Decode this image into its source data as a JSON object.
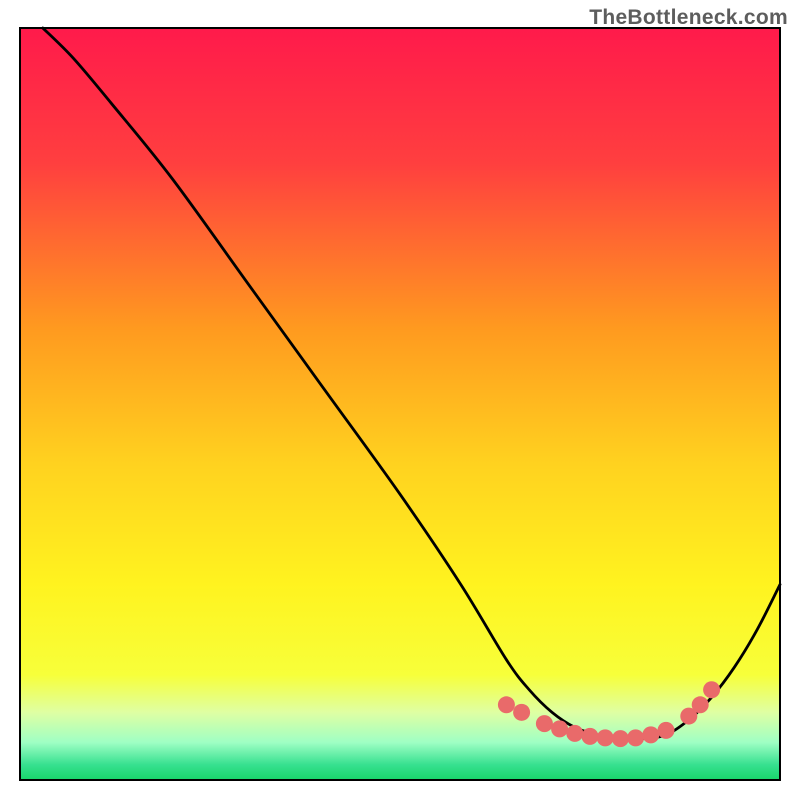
{
  "watermark": "TheBottleneck.com",
  "chart_data": {
    "type": "line",
    "title": "",
    "xlabel": "",
    "ylabel": "",
    "xlim": [
      0,
      100
    ],
    "ylim": [
      0,
      100
    ],
    "gradient_stops": [
      {
        "offset": 0,
        "color": "#ff1a4b"
      },
      {
        "offset": 18,
        "color": "#ff3f3f"
      },
      {
        "offset": 40,
        "color": "#ff9a1f"
      },
      {
        "offset": 58,
        "color": "#ffd21f"
      },
      {
        "offset": 74,
        "color": "#fff31f"
      },
      {
        "offset": 86,
        "color": "#f7ff3a"
      },
      {
        "offset": 91,
        "color": "#dfffa3"
      },
      {
        "offset": 95,
        "color": "#9fffc4"
      },
      {
        "offset": 98,
        "color": "#36en/a"
      },
      {
        "offset": 100,
        "color": "#18d56a"
      }
    ],
    "series": [
      {
        "name": "bottleneck-curve",
        "x": [
          3,
          7,
          12,
          20,
          30,
          40,
          50,
          58,
          64,
          67,
          70,
          73,
          76,
          79,
          82,
          85,
          88,
          91,
          94,
          97,
          100
        ],
        "y": [
          100,
          96,
          90,
          80,
          66,
          52,
          38,
          26,
          16,
          12,
          9,
          7,
          6,
          5.5,
          5.5,
          6,
          8,
          11,
          15,
          20,
          26
        ]
      }
    ],
    "markers": {
      "name": "bottom-dots",
      "color": "#e96a6a",
      "points": [
        {
          "x": 64,
          "y": 10
        },
        {
          "x": 66,
          "y": 9
        },
        {
          "x": 69,
          "y": 7.5
        },
        {
          "x": 71,
          "y": 6.8
        },
        {
          "x": 73,
          "y": 6.2
        },
        {
          "x": 75,
          "y": 5.8
        },
        {
          "x": 77,
          "y": 5.6
        },
        {
          "x": 79,
          "y": 5.5
        },
        {
          "x": 81,
          "y": 5.6
        },
        {
          "x": 83,
          "y": 6.0
        },
        {
          "x": 85,
          "y": 6.6
        },
        {
          "x": 88,
          "y": 8.5
        },
        {
          "x": 89.5,
          "y": 10
        },
        {
          "x": 91,
          "y": 12
        }
      ]
    }
  }
}
